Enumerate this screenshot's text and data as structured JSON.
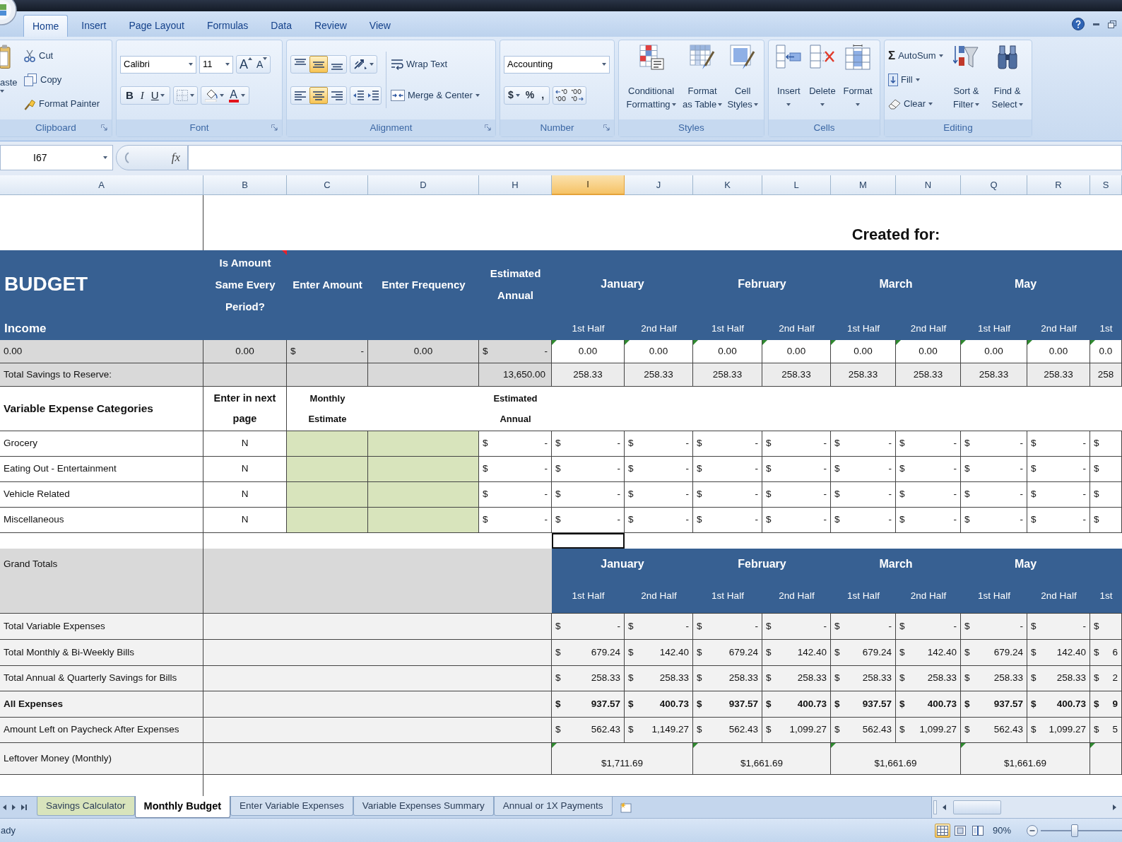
{
  "ribbon_tabs": [
    {
      "label": "Home",
      "selected": true
    },
    {
      "label": "Insert",
      "selected": false
    },
    {
      "label": "Page Layout",
      "selected": false
    },
    {
      "label": "Formulas",
      "selected": false
    },
    {
      "label": "Data",
      "selected": false
    },
    {
      "label": "Review",
      "selected": false
    },
    {
      "label": "View",
      "selected": false
    }
  ],
  "clipboard": {
    "title": "Clipboard",
    "paste": "aste",
    "cut": "Cut",
    "copy": "Copy",
    "format_painter": "Format Painter"
  },
  "font": {
    "title": "Font",
    "name": "Calibri",
    "size": "11",
    "grow": "A",
    "shrink": "A",
    "buttons": [
      {
        "kind": "bold",
        "text": "B"
      },
      {
        "kind": "italic",
        "text": "I"
      },
      {
        "kind": "underline",
        "text": "U"
      }
    ],
    "color_letter": "A"
  },
  "alignment": {
    "title": "Alignment",
    "vertical": [
      {
        "kind": "top",
        "selected": false
      },
      {
        "kind": "middle",
        "selected": true
      },
      {
        "kind": "bottom",
        "selected": false
      }
    ],
    "horizontal": [
      {
        "kind": "left",
        "selected": false
      },
      {
        "kind": "center",
        "selected": true
      },
      {
        "kind": "right",
        "selected": false
      }
    ],
    "wrap_text": "Wrap Text",
    "merge": "Merge & Center"
  },
  "number": {
    "title": "Number",
    "format": "Accounting",
    "currency": "$",
    "percent": "%",
    "comma": ","
  },
  "styles": {
    "title": "Styles",
    "buttons": [
      {
        "kind": "conditional",
        "lines": [
          "Conditional",
          "Formatting"
        ]
      },
      {
        "kind": "table",
        "lines": [
          "Format",
          "as Table"
        ]
      },
      {
        "kind": "cell",
        "lines": [
          "Cell",
          "Styles"
        ]
      }
    ]
  },
  "cells": {
    "title": "Cells",
    "buttons": [
      {
        "kind": "insert",
        "label": "Insert"
      },
      {
        "kind": "delete",
        "label": "Delete"
      },
      {
        "kind": "format",
        "label": "Format"
      }
    ]
  },
  "editing": {
    "title": "Editing",
    "autosum_symbol": "Σ",
    "autosum": "AutoSum",
    "fill": "Fill",
    "clear": "Clear",
    "sort": [
      "Sort &",
      "Filter"
    ],
    "find": [
      "Find &",
      "Select"
    ]
  },
  "formula_bar": {
    "name_box": "I67",
    "function_label": "fx"
  },
  "columns": [
    {
      "label": "A",
      "selected": false
    },
    {
      "label": "B",
      "selected": false
    },
    {
      "label": "C",
      "selected": false
    },
    {
      "label": "D",
      "selected": false
    },
    {
      "label": "H",
      "selected": false
    },
    {
      "label": "I",
      "selected": true
    },
    {
      "label": "J",
      "selected": false
    },
    {
      "label": "K",
      "selected": false
    },
    {
      "label": "L",
      "selected": false
    },
    {
      "label": "M",
      "selected": false
    },
    {
      "label": "N",
      "selected": false
    },
    {
      "label": "Q",
      "selected": false
    },
    {
      "label": "R",
      "selected": false
    },
    {
      "label": "S",
      "selected": false
    }
  ],
  "sheet": {
    "created_for": "Created for:",
    "header": {
      "title": "BUDGET",
      "subtitle": "Income",
      "columns": [
        {
          "text": "Is Amount Same Every Period?",
          "comment": true
        },
        {
          "text": "Enter Amount",
          "comment": false
        },
        {
          "text": "Enter Frequency",
          "comment": false
        },
        {
          "text": "Estimated Annual",
          "comment": false
        }
      ],
      "months": [
        "January",
        "February",
        "March",
        "May"
      ],
      "halves": [
        "1st Half",
        "2nd Half",
        "1st Half",
        "2nd Half",
        "1st Half",
        "2nd Half",
        "1st Half",
        "2nd Half",
        "1st"
      ]
    },
    "income_row": {
      "label": "0.00",
      "same": "0.00",
      "amount": {
        "currency": "$",
        "value": "-"
      },
      "frequency": "0.00",
      "annual": {
        "currency": "$",
        "value": "-"
      },
      "periods": [
        {
          "value": "0.00",
          "flagged": true
        },
        {
          "value": "0.00",
          "flagged": true
        },
        {
          "value": "0.00",
          "flagged": true
        },
        {
          "value": "0.00",
          "flagged": true
        },
        {
          "value": "0.00",
          "flagged": true
        },
        {
          "value": "0.00",
          "flagged": true
        },
        {
          "value": "0.00",
          "flagged": true
        },
        {
          "value": "0.00",
          "flagged": true
        },
        {
          "value": "0.0",
          "flagged": true
        }
      ]
    },
    "savings_row": {
      "label": "Total Savings to Reserve:",
      "annual": "13,650.00",
      "periods": [
        "258.33",
        "258.33",
        "258.33",
        "258.33",
        "258.33",
        "258.33",
        "258.33",
        "258.33",
        "258"
      ]
    },
    "variable_header": {
      "label": "Variable Expense Categories",
      "next_page": "Enter in next page",
      "monthly": "Monthly Estimate",
      "annual": "Estimated Annual"
    },
    "expenses": [
      {
        "label": "Grocery",
        "next_page": "N",
        "annual": {
          "currency": "$",
          "value": "-"
        },
        "periods": [
          {
            "currency": "$",
            "value": "-"
          },
          {
            "currency": "$",
            "value": "-"
          },
          {
            "currency": "$",
            "value": "-"
          },
          {
            "currency": "$",
            "value": "-"
          },
          {
            "currency": "$",
            "value": "-"
          },
          {
            "currency": "$",
            "value": "-"
          },
          {
            "currency": "$",
            "value": "-"
          },
          {
            "currency": "$",
            "value": "-"
          },
          {
            "currency": "$"
          }
        ]
      },
      {
        "label": "Eating Out - Entertainment",
        "next_page": "N",
        "annual": {
          "currency": "$",
          "value": "-"
        },
        "periods": [
          {
            "currency": "$",
            "value": "-"
          },
          {
            "currency": "$",
            "value": "-"
          },
          {
            "currency": "$",
            "value": "-"
          },
          {
            "currency": "$",
            "value": "-"
          },
          {
            "currency": "$",
            "value": "-"
          },
          {
            "currency": "$",
            "value": "-"
          },
          {
            "currency": "$",
            "value": "-"
          },
          {
            "currency": "$",
            "value": "-"
          },
          {
            "currency": "$"
          }
        ]
      },
      {
        "label": "Vehicle Related",
        "next_page": "N",
        "annual": {
          "currency": "$",
          "value": "-"
        },
        "periods": [
          {
            "currency": "$",
            "value": "-"
          },
          {
            "currency": "$",
            "value": "-"
          },
          {
            "currency": "$",
            "value": "-"
          },
          {
            "currency": "$",
            "value": "-"
          },
          {
            "currency": "$",
            "value": "-"
          },
          {
            "currency": "$",
            "value": "-"
          },
          {
            "currency": "$",
            "value": "-"
          },
          {
            "currency": "$",
            "value": "-"
          },
          {
            "currency": "$"
          }
        ]
      },
      {
        "label": "Miscellaneous",
        "next_page": "N",
        "annual": {
          "currency": "$",
          "value": "-"
        },
        "periods": [
          {
            "currency": "$",
            "value": "-"
          },
          {
            "currency": "$",
            "value": "-"
          },
          {
            "currency": "$",
            "value": "-"
          },
          {
            "currency": "$",
            "value": "-"
          },
          {
            "currency": "$",
            "value": "-"
          },
          {
            "currency": "$",
            "value": "-"
          },
          {
            "currency": "$",
            "value": "-"
          },
          {
            "currency": "$",
            "value": "-"
          },
          {
            "currency": "$"
          }
        ]
      }
    ],
    "grand_totals": {
      "label": "Grand Totals",
      "months": [
        "January",
        "February",
        "March",
        "May"
      ],
      "halves": [
        "1st Half",
        "2nd Half",
        "1st Half",
        "2nd Half",
        "1st Half",
        "2nd Half",
        "1st Half",
        "2nd Half",
        "1st"
      ]
    },
    "totals": [
      {
        "label": "Total Variable Expenses",
        "bold": false,
        "cells": [
          {
            "currency": "$",
            "value": "-"
          },
          {
            "currency": "$",
            "value": "-"
          },
          {
            "currency": "$",
            "value": "-"
          },
          {
            "currency": "$",
            "value": "-"
          },
          {
            "currency": "$",
            "value": "-"
          },
          {
            "currency": "$",
            "value": "-"
          },
          {
            "currency": "$",
            "value": "-"
          },
          {
            "currency": "$",
            "value": "-"
          },
          {
            "currency": "$"
          }
        ]
      },
      {
        "label": "Total Monthly & Bi-Weekly Bills",
        "bold": false,
        "cells": [
          {
            "currency": "$",
            "value": "679.24"
          },
          {
            "currency": "$",
            "value": "142.40"
          },
          {
            "currency": "$",
            "value": "679.24"
          },
          {
            "currency": "$",
            "value": "142.40"
          },
          {
            "currency": "$",
            "value": "679.24"
          },
          {
            "currency": "$",
            "value": "142.40"
          },
          {
            "currency": "$",
            "value": "679.24"
          },
          {
            "currency": "$",
            "value": "142.40"
          },
          {
            "currency": "$",
            "value": "6"
          }
        ]
      },
      {
        "label": "Total Annual & Quarterly Savings for Bills",
        "bold": false,
        "cells": [
          {
            "currency": "$",
            "value": "258.33"
          },
          {
            "currency": "$",
            "value": "258.33"
          },
          {
            "currency": "$",
            "value": "258.33"
          },
          {
            "currency": "$",
            "value": "258.33"
          },
          {
            "currency": "$",
            "value": "258.33"
          },
          {
            "currency": "$",
            "value": "258.33"
          },
          {
            "currency": "$",
            "value": "258.33"
          },
          {
            "currency": "$",
            "value": "258.33"
          },
          {
            "currency": "$",
            "value": "2"
          }
        ]
      },
      {
        "label": "All Expenses",
        "bold": true,
        "cells": [
          {
            "currency": "$",
            "value": "937.57"
          },
          {
            "currency": "$",
            "value": "400.73"
          },
          {
            "currency": "$",
            "value": "937.57"
          },
          {
            "currency": "$",
            "value": "400.73"
          },
          {
            "currency": "$",
            "value": "937.57"
          },
          {
            "currency": "$",
            "value": "400.73"
          },
          {
            "currency": "$",
            "value": "937.57"
          },
          {
            "currency": "$",
            "value": "400.73"
          },
          {
            "currency": "$",
            "value": "9"
          }
        ]
      },
      {
        "label": "Amount Left on Paycheck After Expenses",
        "bold": false,
        "cells": [
          {
            "currency": "$",
            "value": "562.43"
          },
          {
            "currency": "$",
            "value": "1,149.27"
          },
          {
            "currency": "$",
            "value": "562.43"
          },
          {
            "currency": "$",
            "value": "1,099.27"
          },
          {
            "currency": "$",
            "value": "562.43"
          },
          {
            "currency": "$",
            "value": "1,099.27"
          },
          {
            "currency": "$",
            "value": "562.43"
          },
          {
            "currency": "$",
            "value": "1,099.27"
          },
          {
            "currency": "$",
            "value": "5"
          }
        ]
      }
    ],
    "leftover": {
      "label": "Leftover Money (Monthly)",
      "cells": [
        {
          "value": "$1,711.69",
          "flagged": true
        },
        {
          "value": "$1,661.69",
          "flagged": true
        },
        {
          "value": "$1,661.69",
          "flagged": true
        },
        {
          "value": "$1,661.69",
          "flagged": true
        },
        {
          "flagged": true
        }
      ]
    }
  },
  "sheet_tabs": [
    {
      "label": "Savings Calculator",
      "selected": false,
      "color": "#d8e4bc"
    },
    {
      "label": "Monthly Budget",
      "selected": true
    },
    {
      "label": "Enter Variable Expenses",
      "selected": false
    },
    {
      "label": "Variable Expenses Summary",
      "selected": false
    },
    {
      "label": "Annual or 1X Payments",
      "selected": false
    }
  ],
  "status": {
    "text": "ady",
    "zoom": "90%",
    "views": [
      {
        "kind": "normal",
        "selected": true
      },
      {
        "kind": "page_layout",
        "selected": false
      },
      {
        "kind": "page_break",
        "selected": false
      }
    ],
    "zoom_slider": {
      "level": 0.42
    }
  }
}
